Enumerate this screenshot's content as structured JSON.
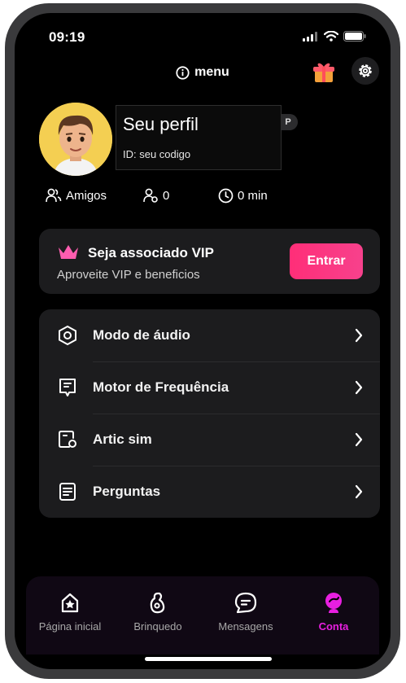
{
  "status": {
    "time": "09:19"
  },
  "header": {
    "title": "menu"
  },
  "profile": {
    "name": "Seu perfil",
    "id_text": "ID: seu codigo",
    "badge": "P",
    "friends_label": "Amigos",
    "followers_count": "0",
    "time_value": "0 min"
  },
  "vip": {
    "title": "Seja associado VIP",
    "subtitle": "Aproveite VIP e beneficios",
    "button_label": "Entrar",
    "accent": "#ff2e78"
  },
  "menu": {
    "items": [
      {
        "label": "Modo de áudio",
        "icon": "hexagon-gear-icon"
      },
      {
        "label": "Motor de Frequência",
        "icon": "chat-doc-icon"
      },
      {
        "label": "Artic sim",
        "icon": "device-pointer-icon"
      },
      {
        "label": "Perguntas",
        "icon": "document-list-icon"
      }
    ]
  },
  "tabs": [
    {
      "label": "Página inicial",
      "icon": "home-star-icon",
      "active": false
    },
    {
      "label": "Brinquedo",
      "icon": "toy-icon",
      "active": false
    },
    {
      "label": "Mensagens",
      "icon": "message-icon",
      "active": false
    },
    {
      "label": "Conta",
      "icon": "account-icon",
      "active": true
    }
  ],
  "colors": {
    "active_tab": "#e81fe0",
    "background": "#000000",
    "card": "#1c1c1e"
  }
}
